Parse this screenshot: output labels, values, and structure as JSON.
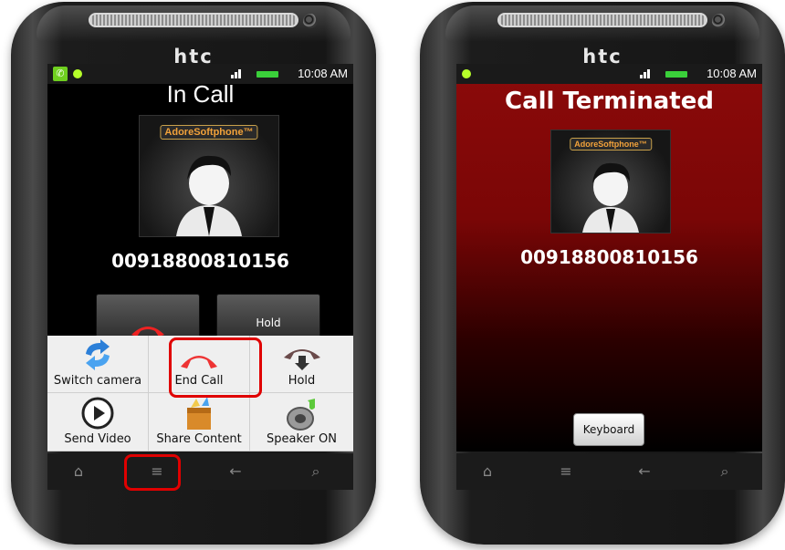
{
  "colors": {
    "terminated_bg": "#8c0a0a",
    "highlight": "#e00000",
    "logo_text": "#f2a23a",
    "status_green": "#3ad03a"
  },
  "left_phone": {
    "brand": "htc",
    "status": {
      "time": "10:08 AM"
    },
    "title": "In Call",
    "avatar_logo": "AdoreSoftphone™",
    "number": "00918800810156",
    "buttons": {
      "hold_label": "Hold"
    },
    "menu": {
      "items": [
        {
          "label": "Switch camera",
          "icon": "switch-camera-icon"
        },
        {
          "label": "End Call",
          "icon": "end-call-icon"
        },
        {
          "label": "Hold",
          "icon": "hold-icon"
        },
        {
          "label": "Send Video",
          "icon": "play-icon"
        },
        {
          "label": "Share Content",
          "icon": "box-icon"
        },
        {
          "label": "Speaker ON",
          "icon": "speaker-icon"
        }
      ]
    },
    "nav": [
      "home-icon",
      "menu-icon",
      "back-icon",
      "search-icon"
    ]
  },
  "right_phone": {
    "brand": "htc",
    "status": {
      "time": "10:08 AM"
    },
    "title": "Call Terminated",
    "avatar_logo": "AdoreSoftphone™",
    "number": "00918800810156",
    "keyboard_label": "Keyboard",
    "nav": [
      "home-icon",
      "menu-icon",
      "back-icon",
      "search-icon"
    ]
  }
}
